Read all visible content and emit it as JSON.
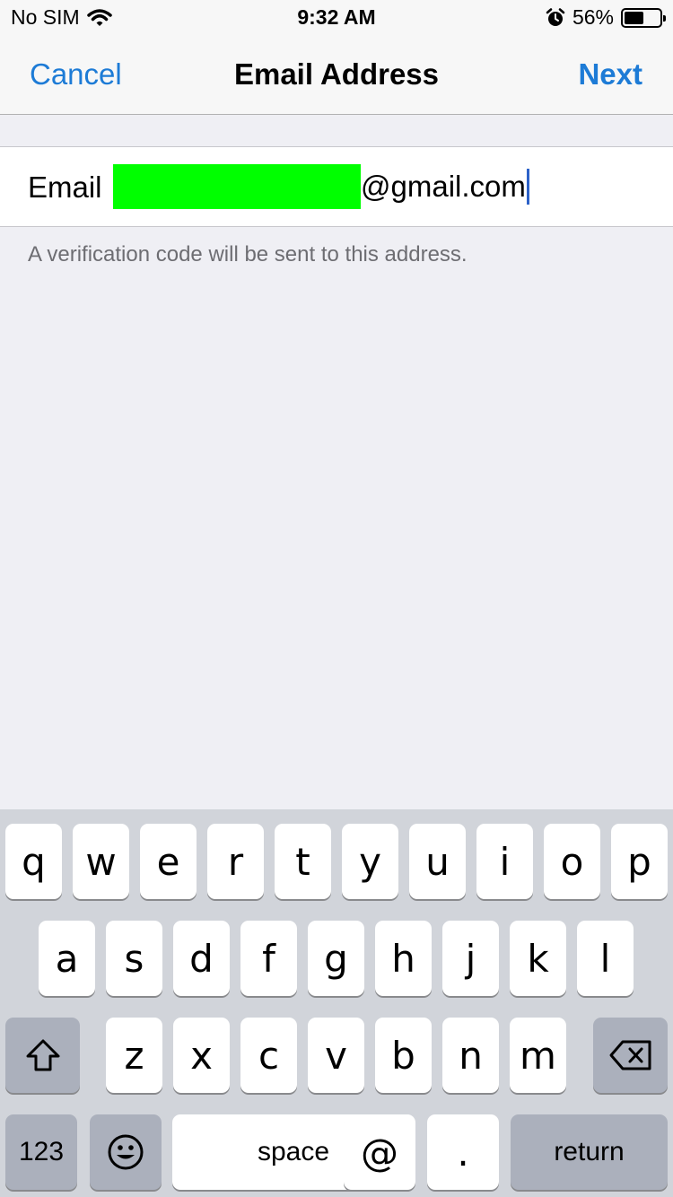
{
  "status_bar": {
    "carrier": "No SIM",
    "time": "9:32 AM",
    "battery_percent": "56%",
    "battery_level": 0.56,
    "icons": [
      "wifi-icon",
      "alarm-icon",
      "battery-icon"
    ]
  },
  "nav": {
    "cancel_label": "Cancel",
    "title": "Email Address",
    "next_label": "Next"
  },
  "form": {
    "email_label": "Email",
    "email_domain": "@gmail.com",
    "hint": "A verification code will be sent to this address."
  },
  "keyboard": {
    "row1": [
      "q",
      "w",
      "e",
      "r",
      "t",
      "y",
      "u",
      "i",
      "o",
      "p"
    ],
    "row2": [
      "a",
      "s",
      "d",
      "f",
      "g",
      "h",
      "j",
      "k",
      "l"
    ],
    "row3": [
      "z",
      "x",
      "c",
      "v",
      "b",
      "n",
      "m"
    ],
    "numbers_label": "123",
    "space_label": "space",
    "at_label": "@",
    "dot_label": ".",
    "return_label": "return",
    "icons": [
      "shift-icon",
      "backspace-icon",
      "emoji-icon"
    ]
  },
  "colors": {
    "accent": "#1d7bd6",
    "redaction": "#00ff00",
    "background": "#efeff4",
    "keyboard_bg": "#d1d4da"
  }
}
